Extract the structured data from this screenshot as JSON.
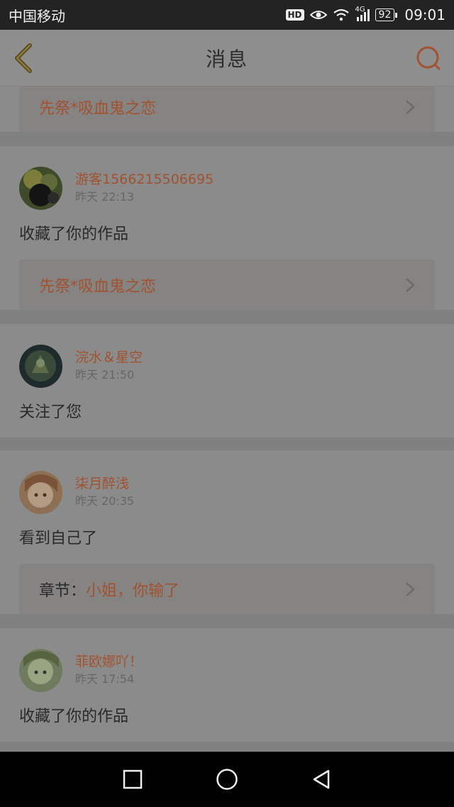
{
  "status_bar": {
    "carrier": "中国移动",
    "hd": "HD",
    "network": "4G",
    "battery": "92",
    "time": "09:01"
  },
  "header": {
    "title": "消息"
  },
  "colors": {
    "accent": "#a1522f",
    "overlay_background": "#8a8a8a"
  },
  "cards": [
    {
      "work_link": {
        "prefix": "",
        "title": "先祭*吸血鬼之恋"
      }
    },
    {
      "username": "游客1566215506695",
      "time": "昨天 22:13",
      "action": "收藏了你的作品",
      "work_link": {
        "prefix": "",
        "title": "先祭*吸血鬼之恋"
      }
    },
    {
      "username": "浣水＆星空",
      "time": "昨天 21:50",
      "action": "关注了您"
    },
    {
      "username": "柒月醉浅",
      "time": "昨天 20:35",
      "action": "看到自己了",
      "work_link": {
        "prefix": "章节：",
        "title": "小姐，你输了"
      }
    },
    {
      "username": "菲欧娜吖！",
      "time": "昨天 17:54",
      "action": "收藏了你的作品"
    }
  ],
  "nav": {
    "icons": [
      "recent-apps-icon",
      "home-icon",
      "back-icon"
    ]
  }
}
